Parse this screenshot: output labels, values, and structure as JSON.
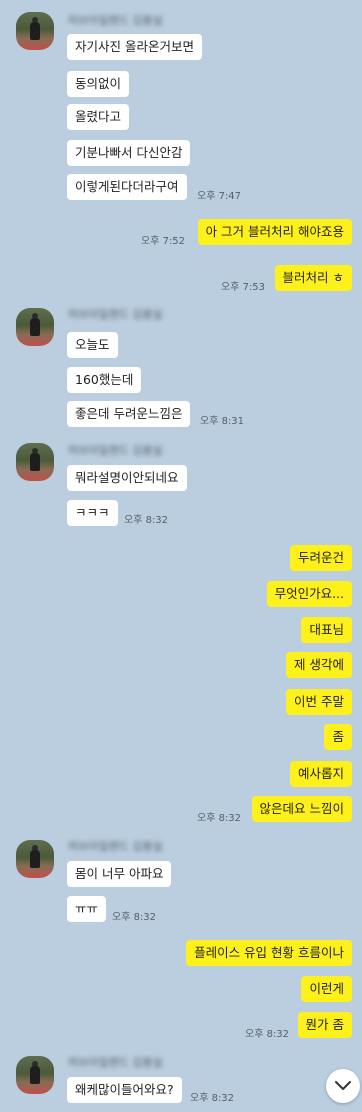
{
  "groups": [
    {
      "sender": "허브아일랜드 김봉실",
      "messages": [
        "자기사진 올라온거보면",
        "동의없이",
        "올렸다고",
        "기분나빠서 다신안감",
        "이렇게된다더라구여"
      ],
      "time": "오후 7:47"
    },
    {
      "messages": [
        "아 그거 블러처리 해야죠용"
      ],
      "time": "오후 7:52"
    },
    {
      "messages": [
        "블러처리 ㅎ"
      ],
      "time": "오후 7:53"
    },
    {
      "sender": "허브아일랜드 김봉실",
      "messages": [
        "오늘도",
        "160했는데",
        "좋은데 두려운느낌은"
      ],
      "time": "오후 8:31"
    },
    {
      "sender": "허브아일랜드 김봉실",
      "messages": [
        "뭐라설명이안되네요",
        "ㅋㅋㅋ"
      ],
      "time": "오후 8:32"
    },
    {
      "messages": [
        "두려운건",
        "무엇인가요...",
        "대표님",
        "제 생각에",
        "이번 주말",
        "좀",
        "예사롭지",
        "않은데요 느낌이"
      ],
      "time": "오후 8:32"
    },
    {
      "sender": "허브아일랜드 김봉실",
      "messages": [
        "몸이 너무 아파요",
        "ㅠㅠ"
      ],
      "time": "오후 8:32"
    },
    {
      "messages": [
        "플레이스 유입 현황 흐름이나",
        "이런게",
        "뭔가 좀"
      ],
      "time": "오후 8:32"
    },
    {
      "sender": "허브아일랜드 김봉실",
      "messages": [
        "왜케많이들어와요?"
      ],
      "time": "오후 8:32"
    }
  ],
  "scroll_button_icon": "chevron-down-icon"
}
